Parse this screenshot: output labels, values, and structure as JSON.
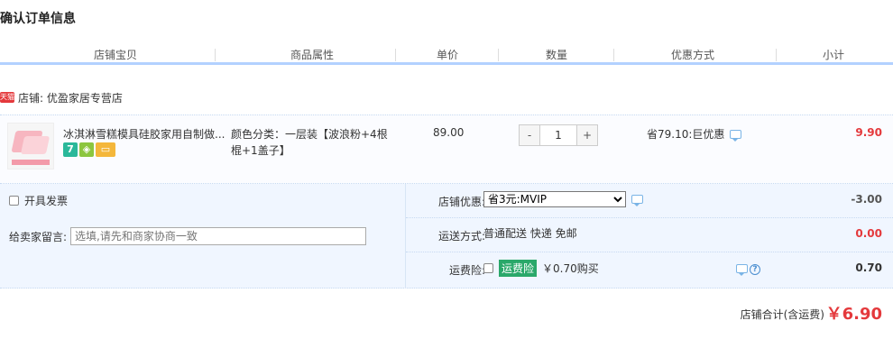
{
  "page": {
    "title": "确认订单信息"
  },
  "columns": [
    "店铺宝贝",
    "商品属性",
    "单价",
    "数量",
    "优惠方式",
    "小计"
  ],
  "shop": {
    "badge": "天猫",
    "label": "店铺: 优盈家居专营店"
  },
  "item": {
    "name": "冰淇淋雪糕模具硅胶家用自制做...",
    "service_icons": [
      "seven-day-return-icon",
      "shield-icon",
      "credit-card-icon"
    ],
    "service_icon_7_text": "7",
    "attr_line1": "颜色分类：一层装【波浪粉+4根",
    "attr_line2": "棍+1盖子】",
    "price": "89.00",
    "quantity": "1",
    "qty_minus": "-",
    "qty_plus": "+",
    "discount": "省79.10:巨优惠",
    "subtotal": "9.90"
  },
  "invoice": {
    "label": "开具发票",
    "checked": false
  },
  "memo": {
    "label": "给卖家留言:",
    "placeholder": "选填,请先和商家协商一致"
  },
  "shop_discount": {
    "label": "店铺优惠:",
    "selected": "省3元:MVIP",
    "amount": "-3.00"
  },
  "shipping": {
    "label": "运送方式:",
    "value": "普通配送 快递 免邮",
    "amount": "0.00"
  },
  "insurance": {
    "label": "运费险:",
    "tag": "运费险",
    "price_text": "￥0.70购买",
    "amount": "0.70",
    "help": "?"
  },
  "footer": {
    "total_label": "店铺合计(含运费)",
    "total_value": "￥6.90"
  },
  "colors": {
    "accent": "#b2d1ff",
    "price_red": "#e4393c",
    "panel_bg": "#f0f6ff",
    "insurance_green": "#2aa86a"
  }
}
